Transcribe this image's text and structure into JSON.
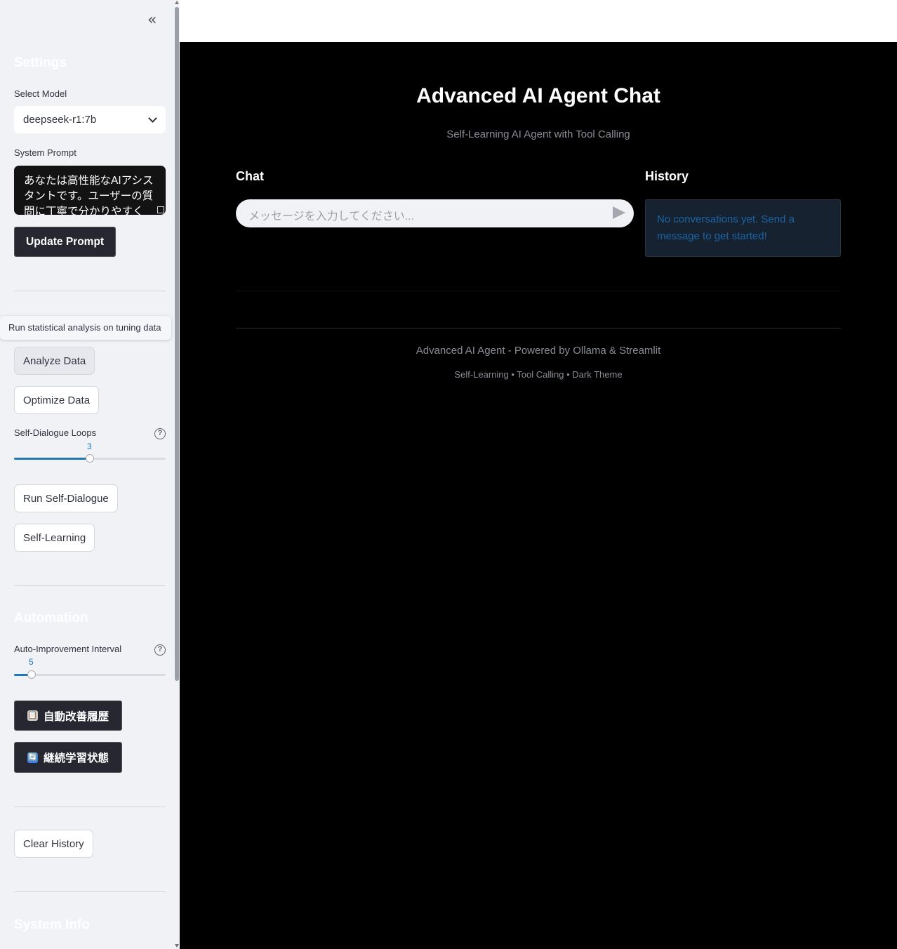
{
  "sidebar": {
    "collapse_icon": "«",
    "settings_heading": "Settings",
    "select_model_label": "Select Model",
    "selected_model": "deepseek-r1:7b",
    "system_prompt_label": "System Prompt",
    "system_prompt_value": "あなたは高性能なAIアシスタントです。ユーザーの質問に丁寧で分かりやすく",
    "update_prompt_button": "Update Prompt",
    "tooltip_text": "Run statistical analysis on tuning data",
    "analyze_button": "Analyze Data",
    "optimize_button": "Optimize Data",
    "self_dialogue_label": "Self-Dialogue Loops",
    "self_dialogue_value": "3",
    "self_dialogue_fraction": 0.5,
    "run_self_dialogue_button": "Run Self-Dialogue",
    "self_learning_button": "Self-Learning",
    "automation_heading": "Automation",
    "auto_interval_label": "Auto-Improvement Interval",
    "auto_interval_value": "5",
    "auto_interval_fraction": 0.115,
    "auto_history_button": "自動改善履歴",
    "auto_history_icon": "📋",
    "learning_status_button": "継続学習状態",
    "learning_status_icon": "🔄",
    "clear_history_button": "Clear History",
    "system_info_heading": "System Info",
    "help_icon": "?"
  },
  "main": {
    "title": "Advanced AI Agent Chat",
    "subtitle": "Self-Learning AI Agent with Tool Calling",
    "chat_heading": "Chat",
    "chat_placeholder": "メッセージを入力してください...",
    "history_heading": "History",
    "history_empty": "No conversations yet. Send a message to get started!",
    "footer_line1": "Advanced AI Agent - Powered by Ollama & Streamlit",
    "footer_line2": "Self-Learning • Tool Calling • Dark Theme"
  },
  "colors": {
    "sidebar_bg": "#f0f2f6",
    "main_bg": "#000000",
    "accent": "#1f77b4",
    "info_box_bg": "#172230",
    "info_text": "#1a63a5"
  }
}
